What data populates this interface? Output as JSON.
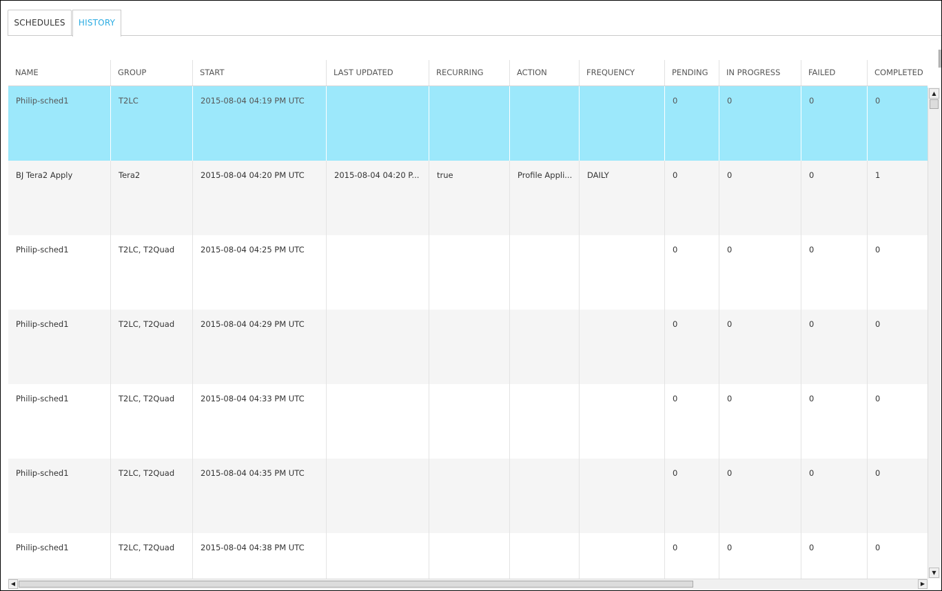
{
  "tabs": {
    "schedules": "SCHEDULES",
    "history": "HISTORY",
    "active": "history"
  },
  "columns": [
    "NAME",
    "GROUP",
    "START",
    "LAST UPDATED",
    "RECURRING",
    "ACTION",
    "FREQUENCY",
    "PENDING",
    "IN PROGRESS",
    "FAILED",
    "COMPLETED"
  ],
  "rows": [
    {
      "name": "Philip-sched1",
      "group": "T2LC",
      "start": "2015-08-04 04:19 PM UTC",
      "last_updated": "",
      "recurring": "",
      "action": "",
      "frequency": "",
      "pending": "0",
      "in_progress": "0",
      "failed": "0",
      "completed": "0",
      "selected": true
    },
    {
      "name": "BJ Tera2 Apply",
      "group": "Tera2",
      "start": "2015-08-04 04:20 PM UTC",
      "last_updated": "2015-08-04 04:20 P...",
      "recurring": "true",
      "action": "Profile Appli...",
      "frequency": "DAILY",
      "pending": "0",
      "in_progress": "0",
      "failed": "0",
      "completed": "1",
      "selected": false
    },
    {
      "name": "Philip-sched1",
      "group": "T2LC, T2Quad",
      "start": "2015-08-04 04:25 PM UTC",
      "last_updated": "",
      "recurring": "",
      "action": "",
      "frequency": "",
      "pending": "0",
      "in_progress": "0",
      "failed": "0",
      "completed": "0",
      "selected": false
    },
    {
      "name": "Philip-sched1",
      "group": "T2LC, T2Quad",
      "start": "2015-08-04 04:29 PM UTC",
      "last_updated": "",
      "recurring": "",
      "action": "",
      "frequency": "",
      "pending": "0",
      "in_progress": "0",
      "failed": "0",
      "completed": "0",
      "selected": false
    },
    {
      "name": "Philip-sched1",
      "group": "T2LC, T2Quad",
      "start": "2015-08-04 04:33 PM UTC",
      "last_updated": "",
      "recurring": "",
      "action": "",
      "frequency": "",
      "pending": "0",
      "in_progress": "0",
      "failed": "0",
      "completed": "0",
      "selected": false
    },
    {
      "name": "Philip-sched1",
      "group": "T2LC, T2Quad",
      "start": "2015-08-04 04:35 PM UTC",
      "last_updated": "",
      "recurring": "",
      "action": "",
      "frequency": "",
      "pending": "0",
      "in_progress": "0",
      "failed": "0",
      "completed": "0",
      "selected": false
    },
    {
      "name": "Philip-sched1",
      "group": "T2LC, T2Quad",
      "start": "2015-08-04 04:38 PM UTC",
      "last_updated": "",
      "recurring": "",
      "action": "",
      "frequency": "",
      "pending": "0",
      "in_progress": "0",
      "failed": "0",
      "completed": "0",
      "selected": false
    }
  ],
  "scrollbar": {
    "up_arrow": "▲",
    "down_arrow": "▼",
    "left_arrow": "◀",
    "right_arrow": "▶",
    "up_arrow_icon": "arrow-up-icon",
    "down_arrow_icon": "arrow-down-icon",
    "left_arrow_icon": "arrow-left-icon",
    "right_arrow_icon": "arrow-right-icon"
  },
  "colors": {
    "accent": "#29abe2",
    "selected_row": "#9ce8fb",
    "alt_row": "#f5f5f5"
  }
}
